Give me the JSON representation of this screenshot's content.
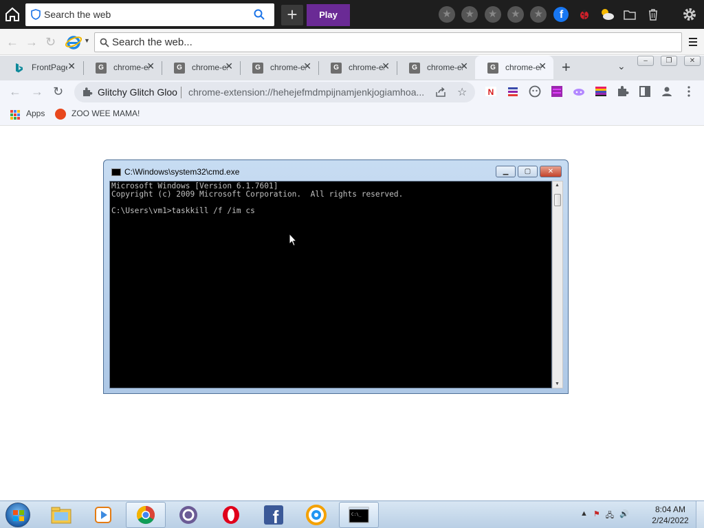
{
  "topbar": {
    "search_placeholder": "Search the web",
    "play_label": "Play",
    "plus_label": "+",
    "icons": [
      "star-icon",
      "star-icon",
      "star-icon",
      "star-icon",
      "star-icon",
      "facebook-icon",
      "ladybug-icon",
      "weather-icon",
      "folder-icon",
      "trash-icon",
      "gear-icon"
    ]
  },
  "ie_bar": {
    "search_placeholder": "Search the web..."
  },
  "tabs": [
    {
      "label": "FrontPage",
      "favicon": "bing-icon"
    },
    {
      "label": "chrome-extension",
      "favicon": "G"
    },
    {
      "label": "chrome-extension",
      "favicon": "G"
    },
    {
      "label": "chrome-extension",
      "favicon": "G"
    },
    {
      "label": "chrome-extension",
      "favicon": "G"
    },
    {
      "label": "chrome-extension",
      "favicon": "G"
    },
    {
      "label": "chrome-extension",
      "favicon": "G",
      "active": true
    }
  ],
  "omnibox": {
    "site_name": "Glitchy Glitch Gloo",
    "url": "chrome-extension://hehejefmdmpijnamjenkjogiamhoa..."
  },
  "bookmarks": [
    {
      "label": "Apps"
    },
    {
      "label": "ZOO WEE MAMA!"
    }
  ],
  "cmd": {
    "title": "C:\\Windows\\system32\\cmd.exe",
    "lines": [
      "Microsoft Windows [Version 6.1.7601]",
      "Copyright (c) 2009 Microsoft Corporation.  All rights reserved.",
      "",
      "C:\\Users\\vm1>taskkill /f /im cs"
    ]
  },
  "taskbar": {
    "apps": [
      "explorer-icon",
      "media-player-icon",
      "chrome-icon",
      "app-circle-icon",
      "opera-icon",
      "facebook-icon",
      "vpn-shield-icon",
      "cmd-icon"
    ],
    "time": "8:04 AM",
    "date": "2/24/2022"
  }
}
